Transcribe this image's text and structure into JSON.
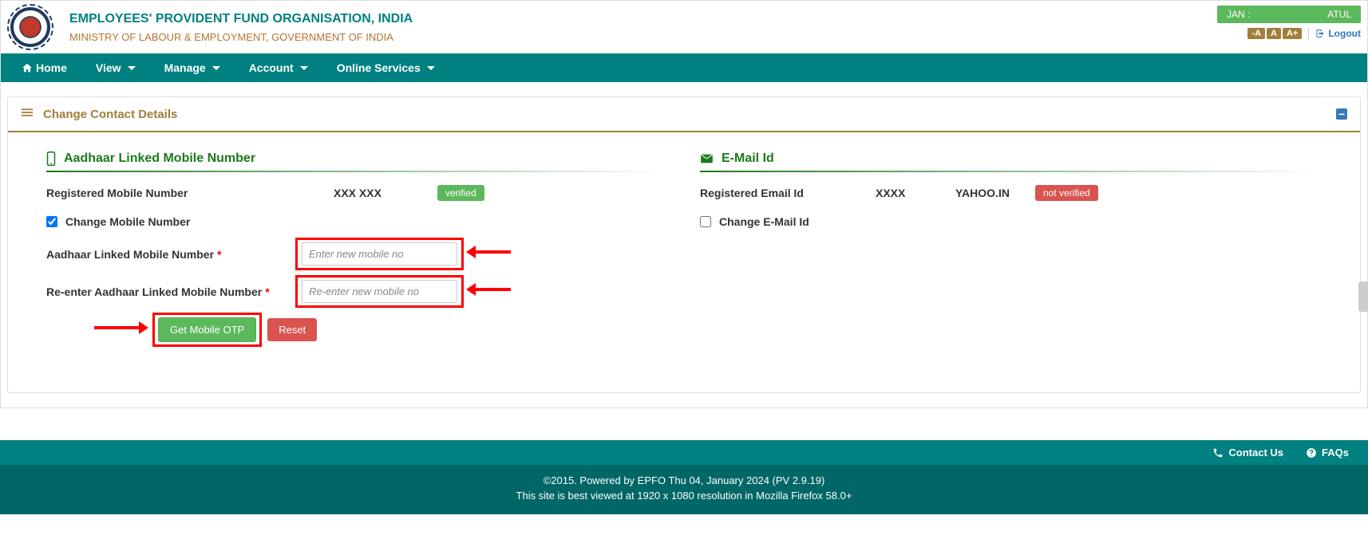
{
  "header": {
    "org_title": "EMPLOYEES' PROVIDENT FUND ORGANISATION, INDIA",
    "ministry_title": "MINISTRY OF LABOUR & EMPLOYMENT, GOVERNMENT OF INDIA",
    "user_left": "JAN :",
    "user_right": "ATUL",
    "font_minus": "-A",
    "font_normal": "A",
    "font_plus": "A+",
    "logout": "Logout"
  },
  "nav": {
    "home": "Home",
    "view": "View",
    "manage": "Manage",
    "account": "Account",
    "online": "Online Services"
  },
  "panel": {
    "title": "Change Contact Details"
  },
  "mobile": {
    "section_title": "Aadhaar Linked Mobile Number",
    "registered_label": "Registered Mobile Number",
    "registered_value": "XXX XXX",
    "verified_badge": "verified",
    "change_checkbox": "Change Mobile Number",
    "new_label": "Aadhaar Linked Mobile Number",
    "new_placeholder": "Enter new mobile no",
    "re_label": "Re-enter Aadhaar Linked Mobile Number",
    "re_placeholder": "Re-enter new mobile no",
    "get_otp": "Get Mobile OTP",
    "reset": "Reset"
  },
  "email": {
    "section_title": "E-Mail Id",
    "registered_label": "Registered Email Id",
    "registered_value": "XXXX",
    "domain": "YAHOO.IN",
    "notverified_badge": "not verified",
    "change_checkbox": "Change E-Mail Id"
  },
  "footer": {
    "contact": "Contact Us",
    "faqs": "FAQs",
    "copyright": "©2015. Powered by EPFO Thu 04, January 2024 (PV 2.9.19)",
    "viewed": "This site is best viewed at 1920 x 1080 resolution in Mozilla Firefox 58.0+"
  }
}
